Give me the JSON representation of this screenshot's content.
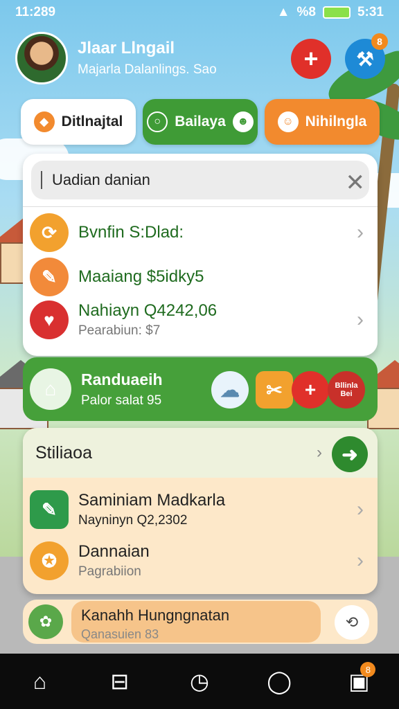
{
  "status": {
    "time": "11:289",
    "right_time": "5:31",
    "signal_text": "%8"
  },
  "header": {
    "title": "Jlaar Llngail",
    "subtitle": "Majarla Dalanlings. Sao",
    "tool_badge": "8"
  },
  "tabs": [
    {
      "label": "Ditlnajtal"
    },
    {
      "label": "Bailaya"
    },
    {
      "label": "Nihilngla"
    }
  ],
  "search": {
    "value": "Uadian danian"
  },
  "list1": [
    {
      "title": "Bvnfin S:Dlad:",
      "sub": ""
    },
    {
      "title": "Maaiang $5idky5",
      "sub": ""
    },
    {
      "title": "Nahiayn Q4242,06",
      "sub": "Pearabiun: $7"
    }
  ],
  "greenbar": {
    "title": "Randuaeih",
    "sub": "Palor salat 95",
    "badge": "Bllinla Bei"
  },
  "card2": {
    "heading": "Stiliaoa",
    "rows": [
      {
        "title": "Saminiam Madkarla",
        "sub": "Nayninyn Q2,2302"
      },
      {
        "title": "Dannaian",
        "sub": "Pagrabiion"
      }
    ]
  },
  "bottom_item": {
    "title": "Kanahh Hungngnatan",
    "sub": "Qanasuien 83"
  },
  "nav": {
    "badge": "8"
  }
}
